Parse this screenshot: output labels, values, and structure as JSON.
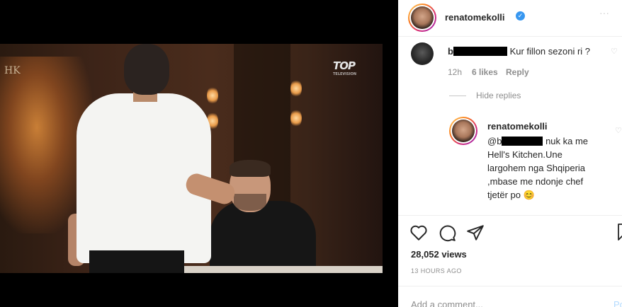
{
  "video": {
    "channel_logo_left": "HK",
    "channel_logo_right": "TOP",
    "channel_logo_right_sub": "TELEVISION"
  },
  "post": {
    "username": "renatomekolli",
    "verified_mark": "✓",
    "more": "···"
  },
  "comments": [
    {
      "username_visible": "b",
      "text": "Kur fillon sezoni ri ?",
      "time": "12h",
      "likes": "6 likes",
      "reply_label": "Reply"
    }
  ],
  "hide_replies_label": "Hide replies",
  "reply": {
    "username": "renatomekolli",
    "mention_visible": "@b",
    "text": "nuk ka me Hell's Kitchen.Une largohem nga Shqiperia ,mbase me ndonje chef tjetër po 😊"
  },
  "actions": {
    "like": "heart-icon",
    "comment": "comment-icon",
    "share": "share-icon",
    "save": "bookmark-icon"
  },
  "stats": {
    "views": "28,052 views",
    "time_ago": "13 HOURS AGO"
  },
  "composer": {
    "placeholder": "Add a comment...",
    "post_label": "Po"
  },
  "colors": {
    "verified": "#3897f0",
    "muted": "#8e8e8e",
    "text": "#262626"
  }
}
